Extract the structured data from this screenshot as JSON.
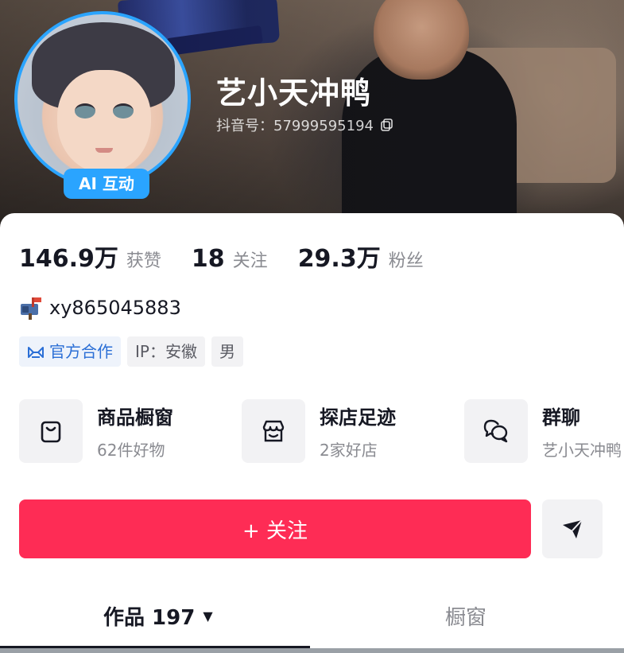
{
  "profile": {
    "nickname": "艺小天冲鸭",
    "douyin_id": "抖音号：57999595194",
    "ai_badge": "AI 互动"
  },
  "stats": [
    {
      "num": "146.9万",
      "label": "获赞"
    },
    {
      "num": "18",
      "label": "关注"
    },
    {
      "num": "29.3万",
      "label": "粉丝"
    }
  ],
  "bio": {
    "wechat": "xy865045883"
  },
  "tags": {
    "official": "官方合作",
    "ip": "IP：安徽",
    "gender": "男"
  },
  "entries": [
    {
      "title": "商品橱窗",
      "sub": "62件好物",
      "icon": "shopping-bag-icon"
    },
    {
      "title": "探店足迹",
      "sub": "2家好店",
      "icon": "store-icon"
    },
    {
      "title": "群聊",
      "sub": "艺小天冲鸭",
      "icon": "chat-bubbles-icon"
    }
  ],
  "actions": {
    "follow": "+ 关注",
    "share_icon": "send-icon"
  },
  "tabs": {
    "works": "作品 197",
    "showcase": "橱窗"
  },
  "colors": {
    "accent": "#fe2c55",
    "avatar_ring": "#2aa4ff"
  }
}
